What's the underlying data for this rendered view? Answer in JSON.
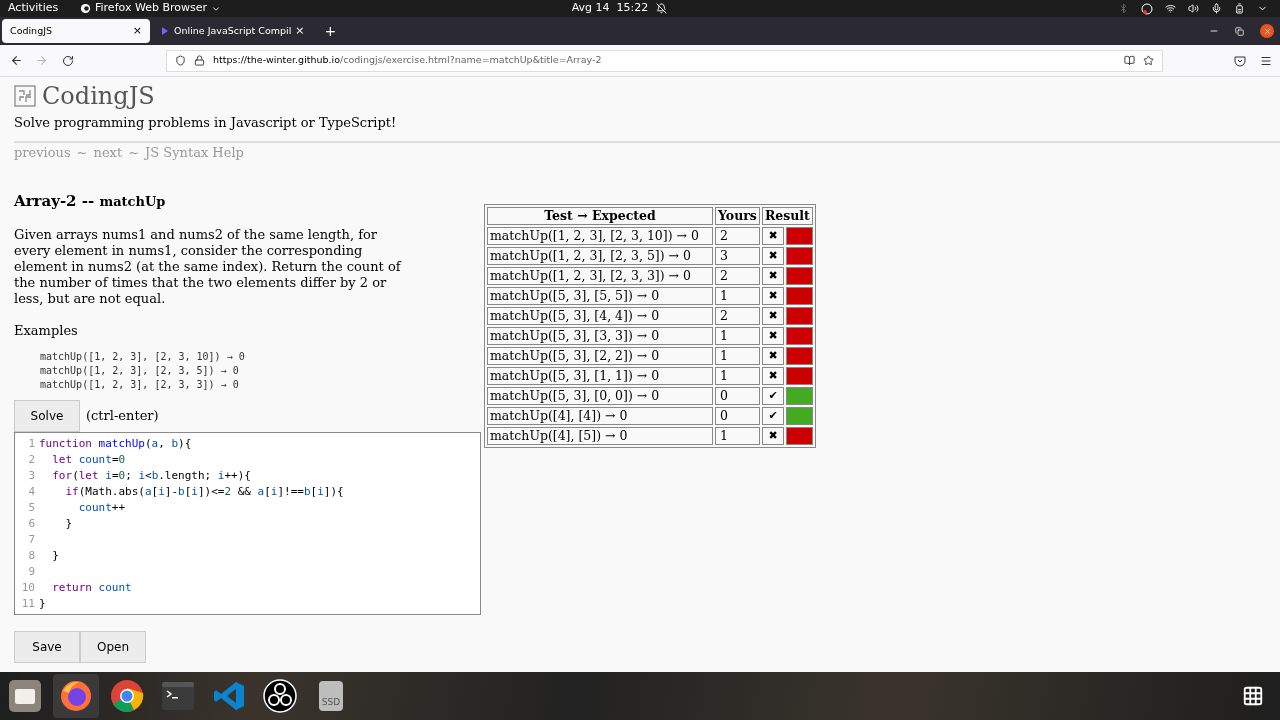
{
  "top_bar": {
    "activities": "Activities",
    "app_menu": "Firefox Web Browser",
    "clock": "Avg 14  15:22"
  },
  "browser": {
    "tabs": [
      {
        "title": "CodingJS",
        "selected": true,
        "close": "×"
      },
      {
        "title": "Online JavaScript Compil",
        "selected": false,
        "close": "×"
      }
    ],
    "new_tab": "+",
    "url_host": "https://the-winter.github.io",
    "url_path": "/codingjs/exercise.html?name=matchUp&title=Array-2"
  },
  "page": {
    "site_title": "CodingJS",
    "tagline": "Solve programming problems in Javascript or TypeScript!",
    "nav_links": [
      {
        "label": "previous"
      },
      {
        "label": "next"
      },
      {
        "label": "JS Syntax Help"
      }
    ],
    "nav_separator": "~",
    "heading": "Array-2 -- ",
    "heading_name": "matchUp",
    "description": "Given arrays nums1 and nums2 of the same length, for every element in nums1, consider the corresponding element in nums2 (at the same index). Return the count of the number of times that the two elements differ by 2 or less, but are not equal.",
    "examples_label": "Examples",
    "examples": [
      "matchUp([1, 2, 3], [2, 3, 10]) → 0",
      "matchUp([1, 2, 3], [2, 3, 5]) → 0",
      "matchUp([1, 2, 3], [2, 3, 3]) → 0"
    ],
    "solve_button": "Solve",
    "solve_hint": "(ctrl-enter)",
    "code": [
      {
        "number": "1",
        "tokens": [
          {
            "text": "function ",
            "kind": "keyword"
          },
          {
            "text": "matchUp",
            "kind": "def"
          },
          {
            "text": "(",
            "kind": "plain"
          },
          {
            "text": "a",
            "kind": "variable"
          },
          {
            "text": ", ",
            "kind": "plain"
          },
          {
            "text": "b",
            "kind": "variable"
          },
          {
            "text": "){",
            "kind": "plain"
          }
        ]
      },
      {
        "number": "2",
        "tokens": [
          {
            "text": "  let ",
            "kind": "keyword"
          },
          {
            "text": "count",
            "kind": "variable"
          },
          {
            "text": "=",
            "kind": "plain"
          },
          {
            "text": "0",
            "kind": "number"
          }
        ]
      },
      {
        "number": "3",
        "tokens": [
          {
            "text": "  for",
            "kind": "keyword"
          },
          {
            "text": "(",
            "kind": "plain"
          },
          {
            "text": "let ",
            "kind": "keyword"
          },
          {
            "text": "i",
            "kind": "variable"
          },
          {
            "text": "=",
            "kind": "plain"
          },
          {
            "text": "0",
            "kind": "number"
          },
          {
            "text": "; ",
            "kind": "plain"
          },
          {
            "text": "i",
            "kind": "variable"
          },
          {
            "text": "<",
            "kind": "plain"
          },
          {
            "text": "b",
            "kind": "variable"
          },
          {
            "text": ".length; ",
            "kind": "plain"
          },
          {
            "text": "i",
            "kind": "variable"
          },
          {
            "text": "++){",
            "kind": "plain"
          }
        ]
      },
      {
        "number": "4",
        "tokens": [
          {
            "text": "    if",
            "kind": "keyword"
          },
          {
            "text": "(Math.abs(",
            "kind": "plain"
          },
          {
            "text": "a",
            "kind": "variable"
          },
          {
            "text": "[",
            "kind": "plain"
          },
          {
            "text": "i",
            "kind": "variable"
          },
          {
            "text": "]-",
            "kind": "plain"
          },
          {
            "text": "b",
            "kind": "variable"
          },
          {
            "text": "[",
            "kind": "plain"
          },
          {
            "text": "i",
            "kind": "variable"
          },
          {
            "text": "])<=",
            "kind": "plain"
          },
          {
            "text": "2",
            "kind": "number"
          },
          {
            "text": " && ",
            "kind": "plain"
          },
          {
            "text": "a",
            "kind": "variable"
          },
          {
            "text": "[",
            "kind": "plain"
          },
          {
            "text": "i",
            "kind": "variable"
          },
          {
            "text": "]!==",
            "kind": "plain"
          },
          {
            "text": "b",
            "kind": "variable"
          },
          {
            "text": "[",
            "kind": "plain"
          },
          {
            "text": "i",
            "kind": "variable"
          },
          {
            "text": "]){",
            "kind": "plain"
          }
        ]
      },
      {
        "number": "5",
        "tokens": [
          {
            "text": "      count",
            "kind": "variable"
          },
          {
            "text": "++",
            "kind": "plain"
          }
        ]
      },
      {
        "number": "6",
        "tokens": [
          {
            "text": "    }",
            "kind": "plain"
          }
        ]
      },
      {
        "number": "7"
      },
      {
        "number": "8",
        "tokens": [
          {
            "text": "  }",
            "kind": "plain"
          }
        ]
      },
      {
        "number": "9"
      },
      {
        "number": "10",
        "tokens": [
          {
            "text": "  return ",
            "kind": "keyword"
          },
          {
            "text": "count",
            "kind": "variable"
          }
        ]
      },
      {
        "number": "11",
        "tokens": [
          {
            "text": "}",
            "kind": "plain"
          }
        ]
      }
    ],
    "bottom_buttons": [
      "Save",
      "Open"
    ],
    "table": {
      "columns": [
        "Test → Expected",
        "Yours",
        "Result"
      ],
      "rows": [
        {
          "test": "matchUp([1, 2, 3], [2, 3, 10]) → 0",
          "yours": "2",
          "mark": "✖",
          "passed": false
        },
        {
          "test": "matchUp([1, 2, 3], [2, 3, 5]) → 0",
          "yours": "3",
          "mark": "✖",
          "passed": false
        },
        {
          "test": "matchUp([1, 2, 3], [2, 3, 3]) → 0",
          "yours": "2",
          "mark": "✖",
          "passed": false
        },
        {
          "test": "matchUp([5, 3], [5, 5]) → 0",
          "yours": "1",
          "mark": "✖",
          "passed": false
        },
        {
          "test": "matchUp([5, 3], [4, 4]) → 0",
          "yours": "2",
          "mark": "✖",
          "passed": false
        },
        {
          "test": "matchUp([5, 3], [3, 3]) → 0",
          "yours": "1",
          "mark": "✖",
          "passed": false
        },
        {
          "test": "matchUp([5, 3], [2, 2]) → 0",
          "yours": "1",
          "mark": "✖",
          "passed": false
        },
        {
          "test": "matchUp([5, 3], [1, 1]) → 0",
          "yours": "1",
          "mark": "✖",
          "passed": false
        },
        {
          "test": "matchUp([5, 3], [0, 0]) → 0",
          "yours": "0",
          "mark": "✔",
          "passed": true
        },
        {
          "test": "matchUp([4], [4]) → 0",
          "yours": "0",
          "mark": "✔",
          "passed": true
        },
        {
          "test": "matchUp([4], [5]) → 0",
          "yours": "1",
          "mark": "✖",
          "passed": false
        }
      ]
    }
  },
  "dock": {
    "apps": [
      {
        "kind": "files",
        "selected": false
      },
      {
        "kind": "firefox",
        "selected": true
      },
      {
        "kind": "chrome",
        "selected": false
      },
      {
        "kind": "terminal",
        "selected": false
      },
      {
        "kind": "vscode",
        "selected": false
      },
      {
        "kind": "obs",
        "selected": false
      },
      {
        "kind": "drive",
        "selected": false
      }
    ],
    "drive_label": "SSD"
  }
}
